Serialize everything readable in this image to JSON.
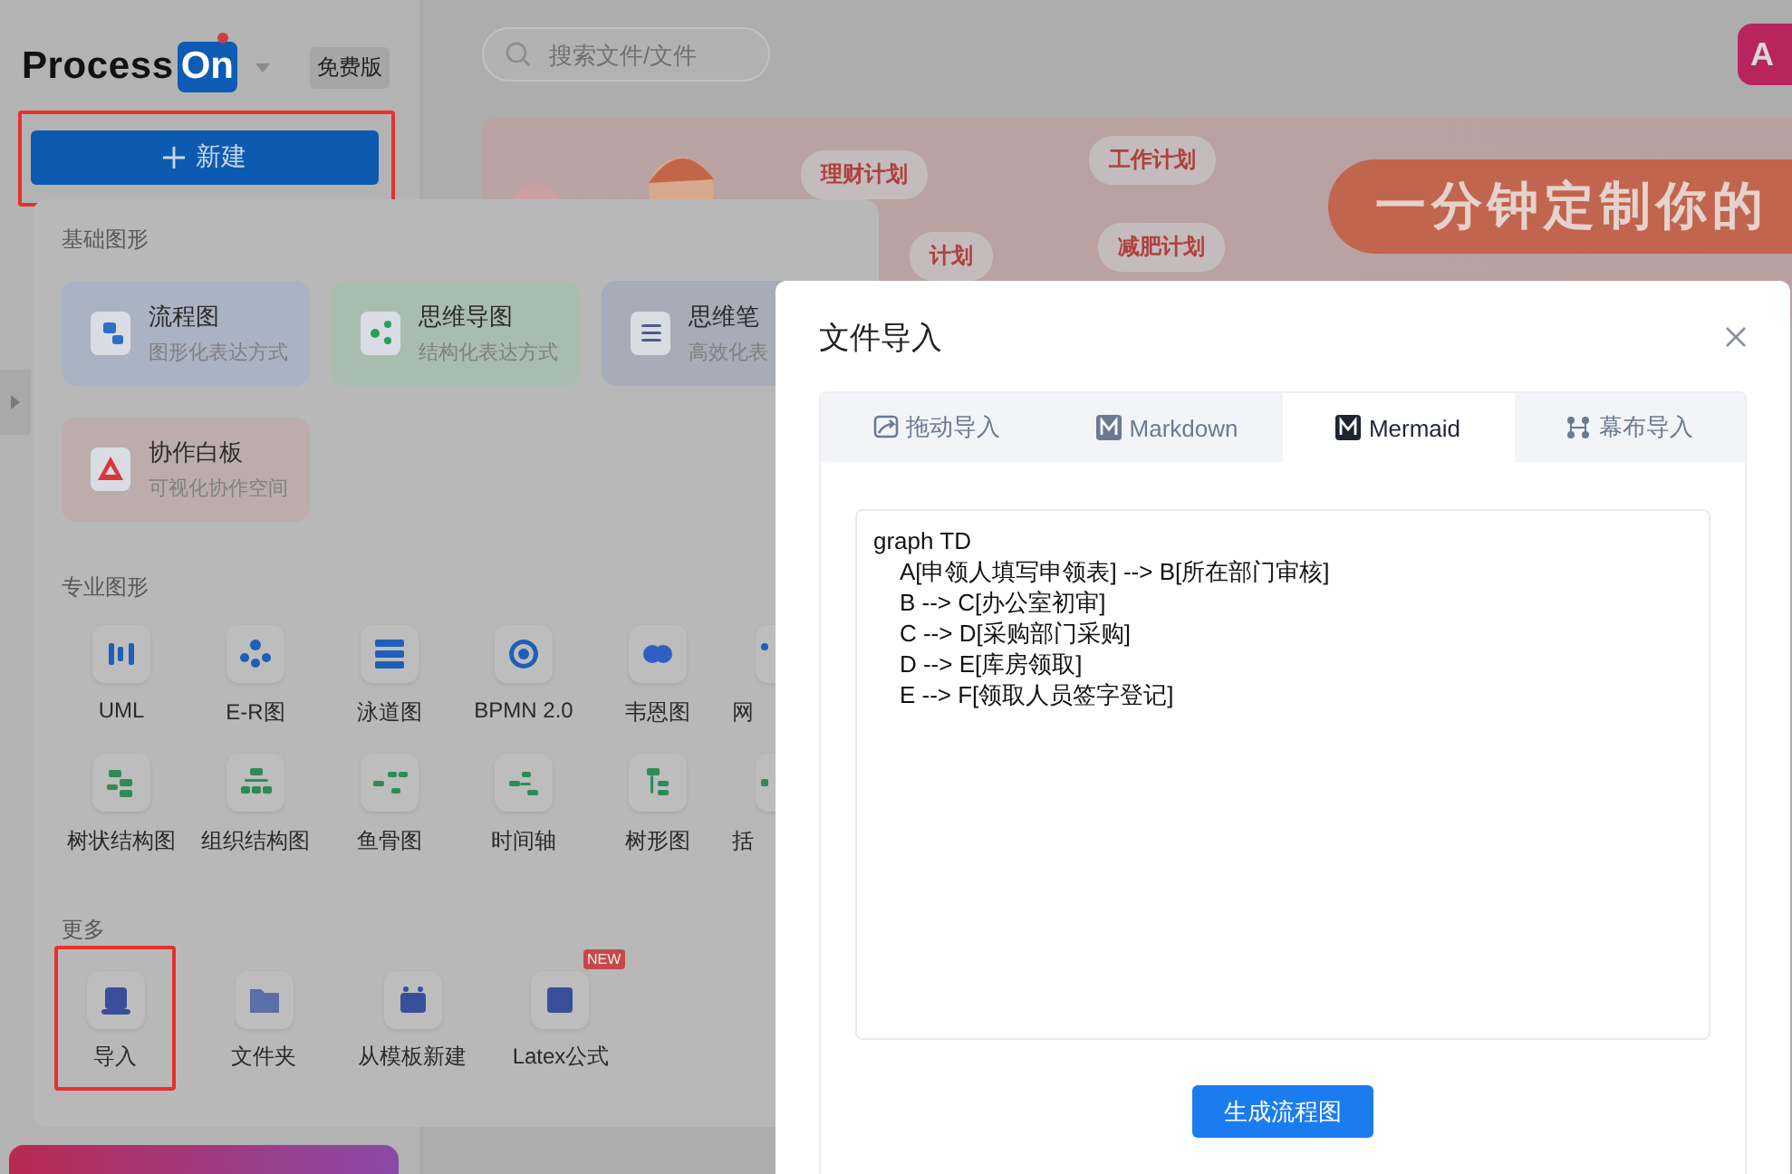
{
  "sidebar": {
    "logo_text": "Process",
    "logo_badge": "On",
    "plan_badge": "免费版",
    "new_button": "新建"
  },
  "search": {
    "placeholder": "搜索文件/文件"
  },
  "top_button": {
    "label": "A"
  },
  "banner": {
    "tags": [
      "理财计划",
      "工作计划",
      "计划",
      "减肥计划"
    ],
    "headline": "一分钟定制你的"
  },
  "create_menu": {
    "basic_title": "基础图形",
    "basic": [
      {
        "kind": "flowchart",
        "title": "流程图",
        "subtitle": "图形化表达方式"
      },
      {
        "kind": "mindmap",
        "title": "思维导图",
        "subtitle": "结构化表达方式"
      },
      {
        "kind": "notes",
        "title": "思维笔",
        "subtitle": "高效化表"
      },
      {
        "kind": "whiteboard",
        "title": "协作白板",
        "subtitle": "可视化协作空间"
      }
    ],
    "pro_title": "专业图形",
    "pro": [
      {
        "kind": "uml",
        "label": "UML"
      },
      {
        "kind": "er",
        "label": "E-R图"
      },
      {
        "kind": "swimlane",
        "label": "泳道图"
      },
      {
        "kind": "bpmn",
        "label": "BPMN 2.0"
      },
      {
        "kind": "venn",
        "label": "韦恩图"
      },
      {
        "kind": "network",
        "label": "网"
      },
      {
        "kind": "tree",
        "label": "树状结构图"
      },
      {
        "kind": "org",
        "label": "组织结构图"
      },
      {
        "kind": "fishbone",
        "label": "鱼骨图"
      },
      {
        "kind": "timeline",
        "label": "时间轴"
      },
      {
        "kind": "treeform",
        "label": "树形图"
      },
      {
        "kind": "bracket",
        "label": "括"
      }
    ],
    "more_title": "更多",
    "more": [
      {
        "kind": "import",
        "label": "导入",
        "highlighted": true
      },
      {
        "kind": "folder",
        "label": "文件夹",
        "highlighted": false
      },
      {
        "kind": "template",
        "label": "从模板新建",
        "highlighted": false
      },
      {
        "kind": "latex",
        "label": "Latex公式",
        "highlighted": false,
        "badge": "NEW"
      }
    ]
  },
  "dialog": {
    "title": "文件导入",
    "tabs": [
      {
        "kind": "drag",
        "label": "拖动导入",
        "selected": false
      },
      {
        "kind": "markdown",
        "label": "Markdown",
        "selected": false
      },
      {
        "kind": "mermaid",
        "label": "Mermaid",
        "selected": true
      },
      {
        "kind": "canvas",
        "label": "幕布导入",
        "selected": false
      }
    ],
    "editor": {
      "value": "graph TD\n    A[申领人填写申领表] --> B[所在部门审核]\n    B --> C[办公室初审]\n    C --> D[采购部门采购]\n    D --> E[库房领取]\n    E --> F[领取人员签字登记]\n"
    },
    "generate_button": "生成流程图"
  }
}
